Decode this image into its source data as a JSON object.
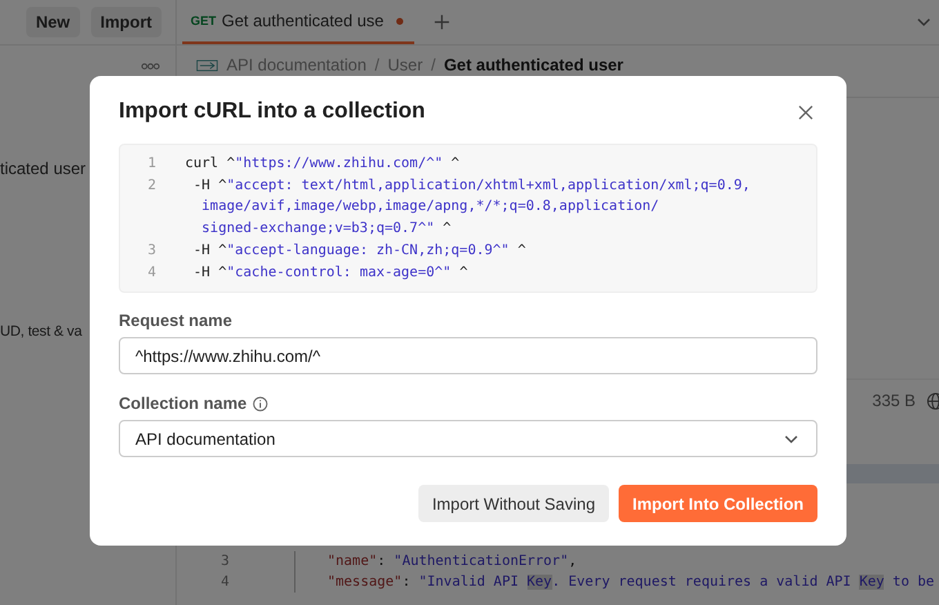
{
  "toolbar": {
    "buttons": [
      "New",
      "Import"
    ]
  },
  "tabs": [
    {
      "method": "GET",
      "label": "Get authenticated use",
      "unsaved": true,
      "selected": true
    }
  ],
  "sidebar": {
    "items": [
      "ticated user",
      "UD, test & va"
    ]
  },
  "breadcrumb": {
    "separator": "/",
    "items": [
      {
        "label": "API documentation",
        "current": false
      },
      {
        "label": "User",
        "current": false
      },
      {
        "label": "Get authenticated user",
        "current": true
      }
    ]
  },
  "response": {
    "size": "335 B",
    "code_lines": [
      {
        "number": "3",
        "tokens": [
          {
            "kind": "key",
            "text": "\"name\""
          },
          {
            "kind": "plain",
            "text": ": "
          },
          {
            "kind": "string",
            "text": "\"AuthenticationError\""
          },
          {
            "kind": "plain",
            "text": ","
          }
        ]
      },
      {
        "number": "4",
        "tokens": [
          {
            "kind": "key",
            "text": "\"message\""
          },
          {
            "kind": "plain",
            "text": ": "
          },
          {
            "kind": "string",
            "text": "\"Invalid API "
          },
          {
            "kind": "match",
            "text": "Key"
          },
          {
            "kind": "string",
            "text": ". Every request requires a valid API "
          },
          {
            "kind": "match",
            "text": "Key"
          },
          {
            "kind": "string",
            "text": " to be"
          }
        ]
      }
    ]
  },
  "dialog": {
    "title": "Import cURL into a collection",
    "code_lines": [
      {
        "number": "1",
        "rows": [
          [
            {
              "kind": "plain",
              "text": "curl ^"
            },
            {
              "kind": "string",
              "text": "\"https://www.zhihu.com/^\""
            },
            {
              "kind": "plain",
              "text": " ^"
            }
          ]
        ]
      },
      {
        "number": "2",
        "rows": [
          [
            {
              "kind": "plain",
              "text": " -H ^"
            },
            {
              "kind": "string",
              "text": "\"accept: text/html,application/xhtml+xml,application/xml;q=0.9,"
            }
          ],
          [
            {
              "kind": "string",
              "text": "  image/avif,image/webp,image/apng,*/*;q=0.8,application/"
            }
          ],
          [
            {
              "kind": "string",
              "text": "  signed-exchange;v=b3;q=0.7^\""
            },
            {
              "kind": "plain",
              "text": " ^"
            }
          ]
        ]
      },
      {
        "number": "3",
        "rows": [
          [
            {
              "kind": "plain",
              "text": " -H ^"
            },
            {
              "kind": "string",
              "text": "\"accept-language: zh-CN,zh;q=0.9^\""
            },
            {
              "kind": "plain",
              "text": " ^"
            }
          ]
        ]
      },
      {
        "number": "4",
        "rows": [
          [
            {
              "kind": "plain",
              "text": " -H ^"
            },
            {
              "kind": "string",
              "text": "\"cache-control: max-age=0^\""
            },
            {
              "kind": "plain",
              "text": " ^"
            }
          ]
        ]
      }
    ],
    "request_name": {
      "label": "Request name",
      "value": "^https://www.zhihu.com/^"
    },
    "collection_name": {
      "label": "Collection name",
      "value": "API documentation"
    },
    "buttons": [
      {
        "label": "Import Without Saving",
        "kind": "secondary"
      },
      {
        "label": "Import Into Collection",
        "kind": "primary"
      }
    ]
  }
}
